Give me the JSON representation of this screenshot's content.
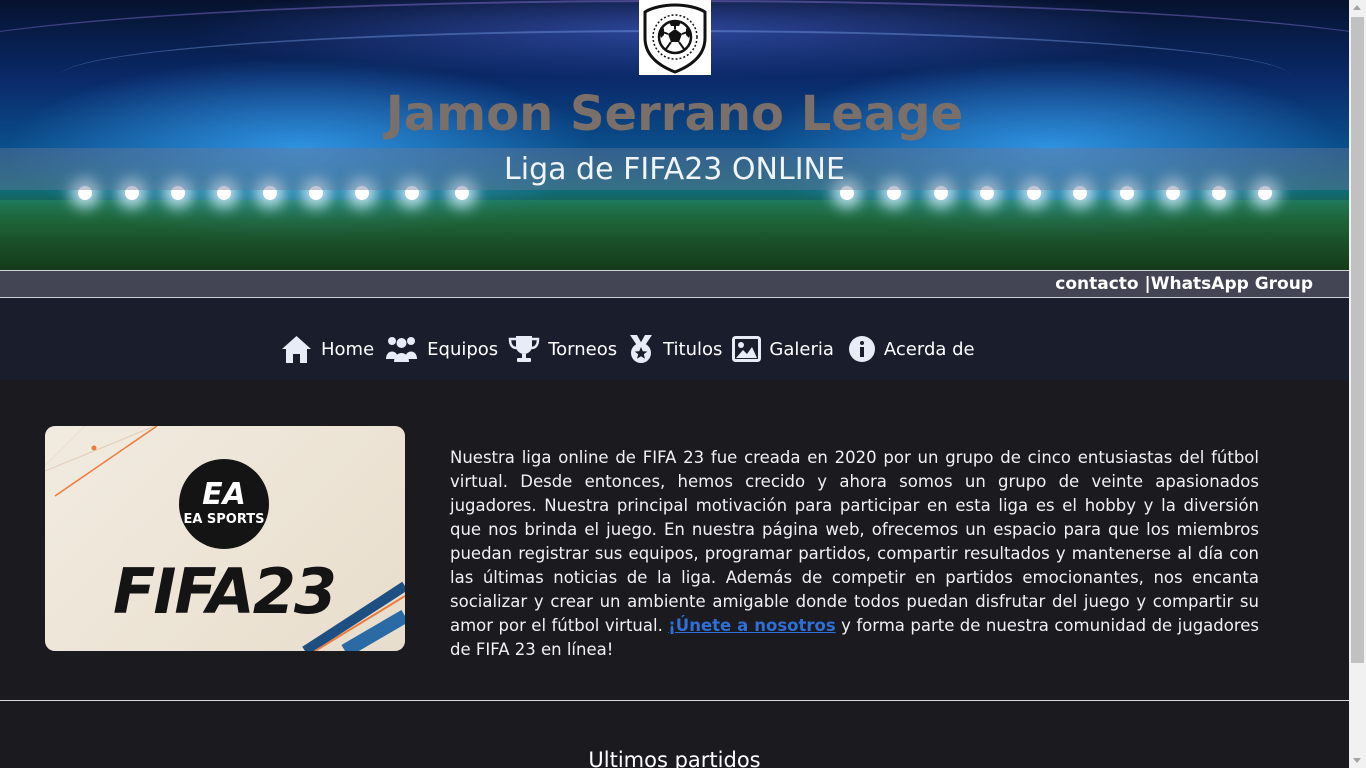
{
  "header": {
    "logo_icon": "soccer-ball-shield-icon",
    "title": "Jamon Serrano Leage",
    "subtitle": "Liga de FIFA23 ONLINE"
  },
  "contact_bar": {
    "contact_label": "contacto |",
    "whatsapp_label": "WhatsApp Group"
  },
  "nav": {
    "items": [
      {
        "label": "Home",
        "icon": "home-icon"
      },
      {
        "label": "Equipos",
        "icon": "users-icon"
      },
      {
        "label": "Torneos",
        "icon": "trophy-icon"
      },
      {
        "label": "Titulos",
        "icon": "medal-icon"
      },
      {
        "label": "Galeria",
        "icon": "image-icon"
      },
      {
        "label": "Acerda de",
        "icon": "info-icon"
      }
    ]
  },
  "intro": {
    "image_brand": "EA SPORTS",
    "image_title": "FIFA 23",
    "text_before": "Nuestra liga online de FIFA 23 fue creada en 2020 por un grupo de cinco entusiastas del fútbol virtual. Desde entonces, hemos crecido y ahora somos un grupo de veinte apasionados jugadores. Nuestra principal motivación para participar en esta liga es el hobby y la diversión que nos brinda el juego. En nuestra página web, ofrecemos un espacio para que los miembros puedan registrar sus equipos, programar partidos, compartir resultados y mantenerse al día con las últimas noticias de la liga. Además de competir en partidos emocionantes, nos encanta socializar y crear un ambiente amigable donde todos puedan disfrutar del juego y compartir su amor por el fútbol virtual. ",
    "link_text": "¡Únete a nosotros",
    "text_after": " y forma parte de nuestra comunidad de jugadores de FIFA 23 en línea!"
  },
  "sections": {
    "latest_matches_title": "Ultimos partidos"
  },
  "colors": {
    "page_bg": "#1b1a1f",
    "nav_bg": "#191d2c",
    "contact_bar_bg": "#434555",
    "title_color": "#7b6f6a",
    "link_color": "#2f6fd6"
  }
}
